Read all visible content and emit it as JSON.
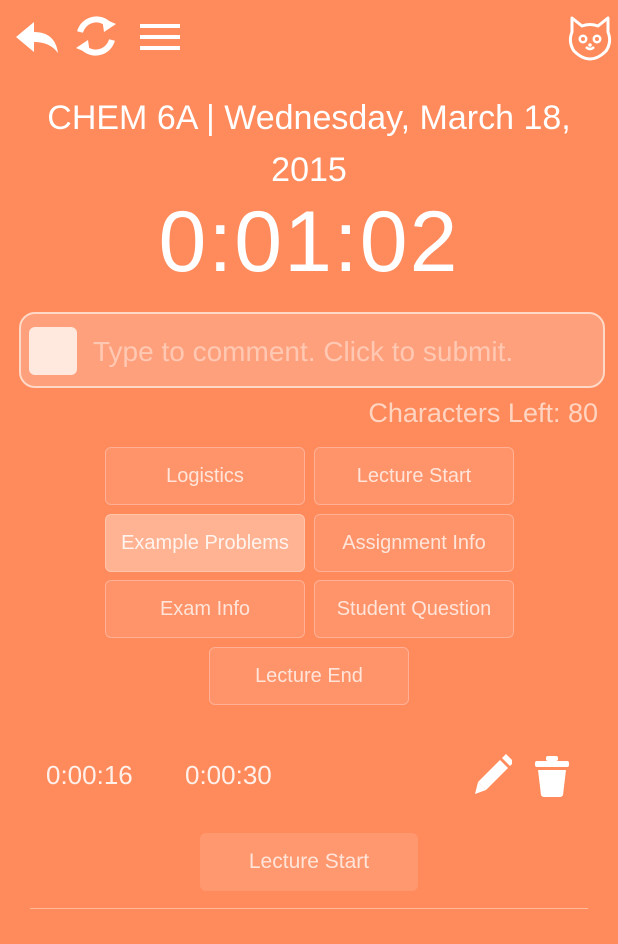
{
  "header": {
    "back_icon": "back-arrow-icon",
    "refresh_icon": "refresh-icon",
    "menu_icon": "hamburger-menu-icon",
    "profile_icon": "cat-face-icon"
  },
  "session": {
    "title": "CHEM 6A | Wednesday, March 18, 2015",
    "timer": "0:01:02"
  },
  "comment": {
    "placeholder": "Type to comment. Click to submit.",
    "value": "",
    "chars_left_label": "Characters Left: 80"
  },
  "tags": [
    {
      "label": "Logistics",
      "selected": false
    },
    {
      "label": "Lecture Start",
      "selected": false
    },
    {
      "label": "Example Problems",
      "selected": true
    },
    {
      "label": "Assignment Info",
      "selected": false
    },
    {
      "label": "Exam Info",
      "selected": false
    },
    {
      "label": "Student Question",
      "selected": false
    },
    {
      "label": "Lecture End",
      "selected": false
    }
  ],
  "entries": [
    {
      "start": "0:00:16",
      "end": "0:00:30",
      "label": "Lecture Start",
      "edit_icon": "pencil-icon",
      "delete_icon": "trash-icon"
    }
  ],
  "colors": {
    "background": "#FF8A5B",
    "text": "#FFFFFF",
    "button": "#FF946A",
    "button_selected": "#FFB393"
  }
}
